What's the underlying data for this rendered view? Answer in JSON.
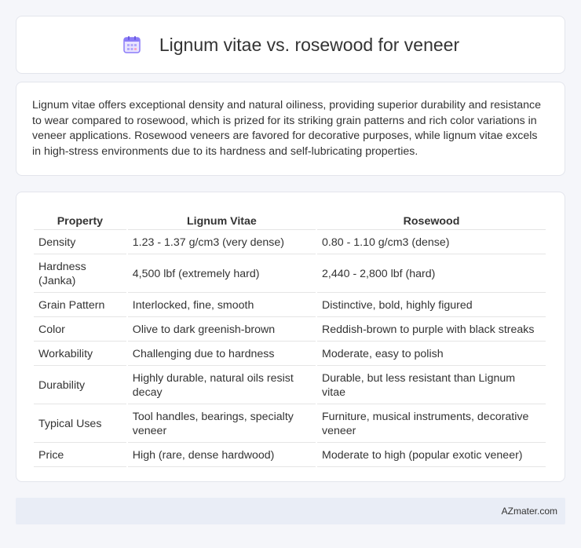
{
  "header": {
    "icon": "calendar-icon",
    "title": "Lignum vitae vs. rosewood for veneer"
  },
  "summary": {
    "text": "Lignum vitae offers exceptional density and natural oiliness, providing superior durability and resistance to wear compared to rosewood, which is prized for its striking grain patterns and rich color variations in veneer applications. Rosewood veneers are favored for decorative purposes, while lignum vitae excels in high-stress environments due to its hardness and self-lubricating properties."
  },
  "table": {
    "headers": [
      "Property",
      "Lignum Vitae",
      "Rosewood"
    ],
    "rows": [
      [
        "Density",
        "1.23 - 1.37 g/cm3 (very dense)",
        "0.80 - 1.10 g/cm3 (dense)"
      ],
      [
        "Hardness (Janka)",
        "4,500 lbf (extremely hard)",
        "2,440 - 2,800 lbf (hard)"
      ],
      [
        "Grain Pattern",
        "Interlocked, fine, smooth",
        "Distinctive, bold, highly figured"
      ],
      [
        "Color",
        "Olive to dark greenish-brown",
        "Reddish-brown to purple with black streaks"
      ],
      [
        "Workability",
        "Challenging due to hardness",
        "Moderate, easy to polish"
      ],
      [
        "Durability",
        "Highly durable, natural oils resist decay",
        "Durable, but less resistant than Lignum vitae"
      ],
      [
        "Typical Uses",
        "Tool handles, bearings, specialty veneer",
        "Furniture, musical instruments, decorative veneer"
      ],
      [
        "Price",
        "High (rare, dense hardwood)",
        "Moderate to high (popular exotic veneer)"
      ]
    ]
  },
  "footer": {
    "text": "AZmater.com"
  },
  "colors": {
    "background": "#f5f6fa",
    "card": "#ffffff",
    "footer_bg": "#e9edf6",
    "icon_accent": "#7b6cf6"
  }
}
